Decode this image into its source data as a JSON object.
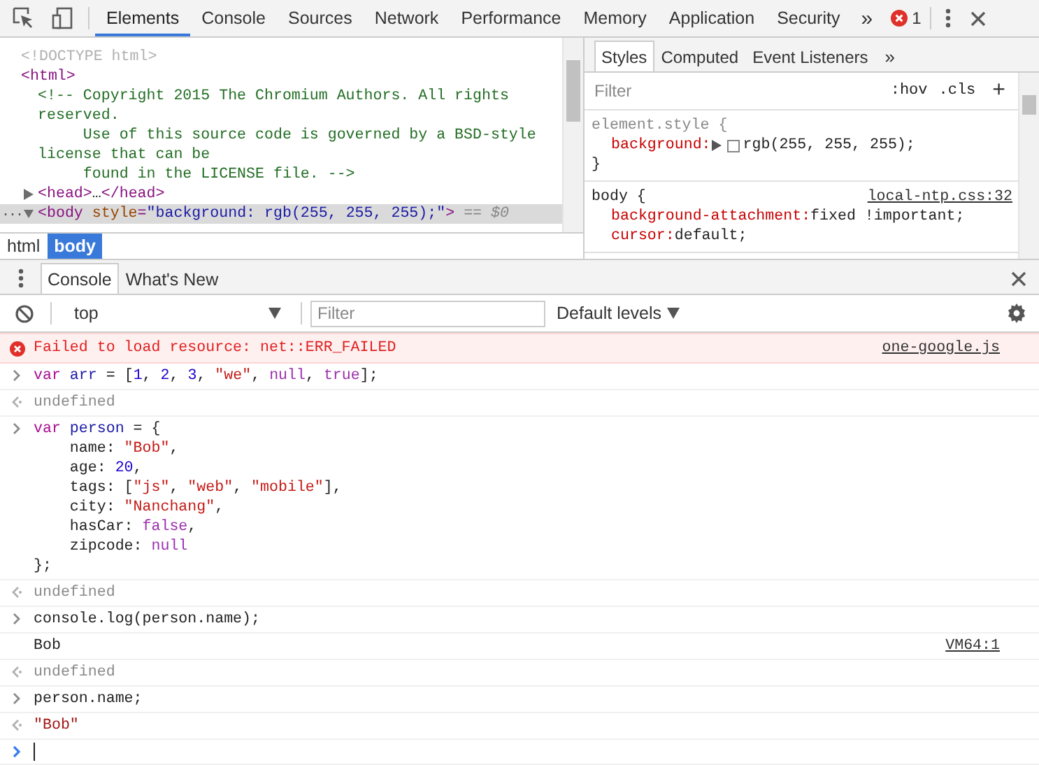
{
  "toolbar": {
    "tabs": [
      {
        "label": "Elements",
        "selected": true
      },
      {
        "label": "Console",
        "selected": false
      },
      {
        "label": "Sources",
        "selected": false
      },
      {
        "label": "Network",
        "selected": false
      },
      {
        "label": "Performance",
        "selected": false
      },
      {
        "label": "Memory",
        "selected": false
      },
      {
        "label": "Application",
        "selected": false
      },
      {
        "label": "Security",
        "selected": false
      }
    ],
    "more": "»",
    "error_count": "1"
  },
  "elements": {
    "dom": [
      {
        "tokens": [
          {
            "text": "<!DOCTYPE html>",
            "kind": "doctype"
          }
        ]
      },
      {
        "tokens": [
          {
            "text": "<html>",
            "kind": "tag"
          }
        ],
        "children": [
          {
            "tokens": [
              {
                "text": "<!-- Copyright 2015 The Chromium Authors. All rights reserved.\n     Use of this source code is governed by a BSD-style license that can be\n     found in the LICENSE file. -->",
                "kind": "comment"
              }
            ]
          },
          {
            "expanded": false,
            "selected": false,
            "tokens": [
              {
                "text": "<head>",
                "kind": "tag"
              },
              {
                "text": "…",
                "kind": "plain"
              },
              {
                "text": "</head>",
                "kind": "tag"
              }
            ]
          },
          {
            "expanded": true,
            "selected": true,
            "gutter": "...",
            "tokens": [
              {
                "text": "<body",
                "kind": "tag"
              },
              {
                "text": " style",
                "kind": "attr"
              },
              {
                "text": "=",
                "kind": "tag"
              },
              {
                "text": "\"background: rgb(255, 255, 255);\"",
                "kind": "attr-value"
              },
              {
                "text": ">",
                "kind": "tag"
              },
              {
                "text": " == $0",
                "kind": "marker"
              }
            ]
          }
        ]
      }
    ],
    "breadcrumbs": [
      {
        "label": "html",
        "selected": false
      },
      {
        "label": "body",
        "selected": true
      }
    ]
  },
  "styles": {
    "tabs": [
      {
        "label": "Styles",
        "selected": true
      },
      {
        "label": "Computed",
        "selected": false
      },
      {
        "label": "Event Listeners",
        "selected": false
      }
    ],
    "more": "»",
    "filter": {
      "placeholder": "Filter"
    },
    "hov": ":hov",
    "cls": ".cls",
    "add": "+",
    "rules": [
      {
        "kind": "inline",
        "selector": "element.style {",
        "close": "}",
        "props": [
          {
            "name": "background:",
            "value": "rgb(255, 255, 255);",
            "expandable": true,
            "swatch": true
          }
        ]
      },
      {
        "kind": "matched",
        "selector": "body {",
        "source": "local-ntp.css:32",
        "props": [
          {
            "name": "background-attachment:",
            "value": "fixed !important;"
          },
          {
            "name": "cursor:",
            "value": "default;"
          }
        ]
      }
    ]
  },
  "drawer": {
    "tabs": [
      {
        "label": "Console",
        "selected": true
      },
      {
        "label": "What's New",
        "selected": false
      }
    ]
  },
  "console_toolbar": {
    "context": "top",
    "filter": {
      "placeholder": "Filter"
    },
    "levels": "Default levels"
  },
  "console": {
    "entries": [
      {
        "kind": "error",
        "source": "one-google.js",
        "lines": [
          [
            {
              "text": "Failed to load resource: net::ERR_FAILED",
              "kind": "error"
            }
          ]
        ]
      },
      {
        "kind": "input",
        "lines": [
          [
            {
              "text": "var",
              "kind": "keyword"
            },
            {
              "text": " arr ",
              "kind": "def"
            },
            {
              "text": "= [",
              "kind": "plain"
            },
            {
              "text": "1",
              "kind": "number"
            },
            {
              "text": ", ",
              "kind": "plain"
            },
            {
              "text": "2",
              "kind": "number"
            },
            {
              "text": ", ",
              "kind": "plain"
            },
            {
              "text": "3",
              "kind": "number"
            },
            {
              "text": ", ",
              "kind": "plain"
            },
            {
              "text": "\"we\"",
              "kind": "string"
            },
            {
              "text": ", ",
              "kind": "plain"
            },
            {
              "text": "null",
              "kind": "atom"
            },
            {
              "text": ", ",
              "kind": "plain"
            },
            {
              "text": "true",
              "kind": "atom"
            },
            {
              "text": "];",
              "kind": "plain"
            }
          ]
        ]
      },
      {
        "kind": "output",
        "lines": [
          [
            {
              "text": "undefined",
              "kind": "muted"
            }
          ]
        ]
      },
      {
        "kind": "input",
        "lines": [
          [
            {
              "text": "var",
              "kind": "keyword"
            },
            {
              "text": " person ",
              "kind": "def"
            },
            {
              "text": "= {",
              "kind": "plain"
            }
          ],
          [
            {
              "text": "    name: ",
              "kind": "plain"
            },
            {
              "text": "\"Bob\"",
              "kind": "string"
            },
            {
              "text": ",",
              "kind": "plain"
            }
          ],
          [
            {
              "text": "    age: ",
              "kind": "plain"
            },
            {
              "text": "20",
              "kind": "number"
            },
            {
              "text": ",",
              "kind": "plain"
            }
          ],
          [
            {
              "text": "    tags: [",
              "kind": "plain"
            },
            {
              "text": "\"js\"",
              "kind": "string"
            },
            {
              "text": ", ",
              "kind": "plain"
            },
            {
              "text": "\"web\"",
              "kind": "string"
            },
            {
              "text": ", ",
              "kind": "plain"
            },
            {
              "text": "\"mobile\"",
              "kind": "string"
            },
            {
              "text": "],",
              "kind": "plain"
            }
          ],
          [
            {
              "text": "    city: ",
              "kind": "plain"
            },
            {
              "text": "\"Nanchang\"",
              "kind": "string"
            },
            {
              "text": ",",
              "kind": "plain"
            }
          ],
          [
            {
              "text": "    hasCar: ",
              "kind": "plain"
            },
            {
              "text": "false",
              "kind": "atom"
            },
            {
              "text": ",",
              "kind": "plain"
            }
          ],
          [
            {
              "text": "    zipcode: ",
              "kind": "plain"
            },
            {
              "text": "null",
              "kind": "atom"
            }
          ],
          [
            {
              "text": "};",
              "kind": "plain"
            }
          ]
        ]
      },
      {
        "kind": "output",
        "lines": [
          [
            {
              "text": "undefined",
              "kind": "muted"
            }
          ]
        ]
      },
      {
        "kind": "input",
        "lines": [
          [
            {
              "text": "console.log(person.name);",
              "kind": "plain"
            }
          ]
        ]
      },
      {
        "kind": "log",
        "source": "VM64:1",
        "lines": [
          [
            {
              "text": "Bob",
              "kind": "plain"
            }
          ]
        ]
      },
      {
        "kind": "output",
        "lines": [
          [
            {
              "text": "undefined",
              "kind": "muted"
            }
          ]
        ]
      },
      {
        "kind": "input",
        "lines": [
          [
            {
              "text": "person.name;",
              "kind": "plain"
            }
          ]
        ]
      },
      {
        "kind": "output",
        "lines": [
          [
            {
              "text": "\"Bob\"",
              "kind": "result-string"
            }
          ]
        ]
      },
      {
        "kind": "prompt"
      }
    ]
  }
}
